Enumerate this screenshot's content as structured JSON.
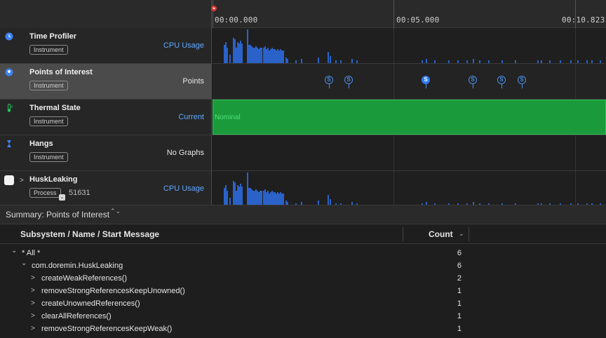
{
  "ruler": {
    "ticks": [
      {
        "label": "00:00.000"
      },
      {
        "label": "00:05.000"
      },
      {
        "label": "00:10.823"
      }
    ]
  },
  "tracks": [
    {
      "id": "time-profiler",
      "title": "Time Profiler",
      "badge": "Instrument",
      "right": "CPU Usage",
      "right_style": "blue",
      "icon": "clock-icon",
      "icon_color": "#3b82f6"
    },
    {
      "id": "points-of-interest",
      "title": "Points of Interest",
      "badge": "Instrument",
      "right": "Points",
      "right_style": "white",
      "icon": "map-pin-icon",
      "icon_color": "#3b82f6"
    },
    {
      "id": "thermal-state",
      "title": "Thermal State",
      "badge": "Instrument",
      "right": "Current",
      "right_style": "blue",
      "icon": "thermometer-icon",
      "icon_color": "#22c55e",
      "state_label": "Nominal"
    },
    {
      "id": "hangs",
      "title": "Hangs",
      "badge": "Instrument",
      "right": "No Graphs",
      "right_style": "white",
      "icon": "hourglass-icon",
      "icon_color": "#3b82f6"
    },
    {
      "id": "husk-leaking",
      "title": "HuskLeaking",
      "badge": "Process",
      "pid": "51631",
      "right": "CPU Usage",
      "right_style": "blue",
      "icon": "checkbox-icon"
    }
  ],
  "poi_glyph": "S",
  "summary": {
    "title": "Summary: Points of Interest",
    "chevrons": "⌃⌄"
  },
  "table": {
    "columns": {
      "name": "Subsystem / Name / Start Message",
      "count": "Count"
    },
    "rows": [
      {
        "name": "* All *",
        "count": "6",
        "level": 0,
        "expanded": true
      },
      {
        "name": "com.doremin.HuskLeaking",
        "count": "6",
        "level": 1,
        "expanded": true
      },
      {
        "name": "createWeakReferences()",
        "count": "2",
        "level": 2,
        "expanded": false
      },
      {
        "name": "removeStrongReferencesKeepUnowned()",
        "count": "1",
        "level": 2,
        "expanded": false
      },
      {
        "name": "createUnownedReferences()",
        "count": "1",
        "level": 2,
        "expanded": false
      },
      {
        "name": "clearAllReferences()",
        "count": "1",
        "level": 2,
        "expanded": false
      },
      {
        "name": "removeStrongReferencesKeepWeak()",
        "count": "1",
        "level": 2,
        "expanded": false
      }
    ]
  },
  "colors": {
    "accent": "#2f7bf0",
    "cpu_bar": "#2a62c9",
    "thermal": "#1b9a3c",
    "link": "#5ea8ff"
  }
}
